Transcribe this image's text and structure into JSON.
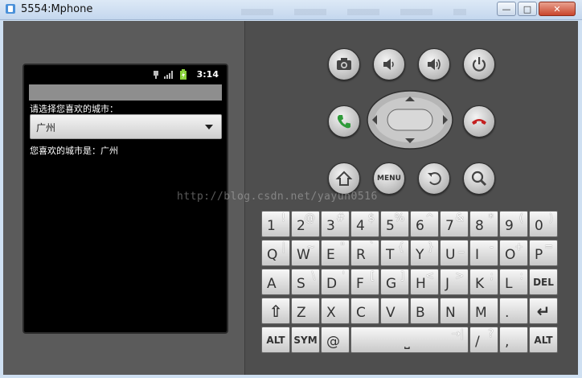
{
  "window": {
    "title": "5554:Mphone",
    "controls": {
      "minimize": "—",
      "maximize": "□",
      "close": "✕"
    }
  },
  "status_bar": {
    "time": "3:14"
  },
  "app": {
    "prompt_label": "请选择您喜欢的城市：",
    "spinner_value": "广州",
    "result_label": "您喜欢的城市是：广州"
  },
  "controls": {
    "camera": "camera-icon",
    "volume_down": "volume-down-icon",
    "volume_up": "volume-up-icon",
    "power": "power-icon",
    "call": "call-icon",
    "end_call": "end-call-icon",
    "home": "home-icon",
    "menu_label": "MENU",
    "back": "back-icon",
    "search": "search-icon"
  },
  "watermark": "http://blog.csdn.net/yayun0516",
  "keyboard": {
    "row1": [
      {
        "main": "1",
        "alt": "!"
      },
      {
        "main": "2",
        "alt": "@"
      },
      {
        "main": "3",
        "alt": "#"
      },
      {
        "main": "4",
        "alt": "$"
      },
      {
        "main": "5",
        "alt": "%"
      },
      {
        "main": "6",
        "alt": "^"
      },
      {
        "main": "7",
        "alt": "&"
      },
      {
        "main": "8",
        "alt": "*"
      },
      {
        "main": "9",
        "alt": "("
      },
      {
        "main": "0",
        "alt": ")"
      }
    ],
    "row2": [
      {
        "main": "Q",
        "alt": "|"
      },
      {
        "main": "W",
        "alt": "~"
      },
      {
        "main": "E",
        "alt": "\""
      },
      {
        "main": "R",
        "alt": "`"
      },
      {
        "main": "T",
        "alt": "{"
      },
      {
        "main": "Y",
        "alt": "}"
      },
      {
        "main": "U",
        "alt": "_"
      },
      {
        "main": "I",
        "alt": "-"
      },
      {
        "main": "O",
        "alt": "+"
      },
      {
        "main": "P",
        "alt": "="
      }
    ],
    "row3": [
      {
        "main": "A",
        "alt": ""
      },
      {
        "main": "S",
        "alt": "\\"
      },
      {
        "main": "D",
        "alt": "'"
      },
      {
        "main": "F",
        "alt": "["
      },
      {
        "main": "G",
        "alt": "]"
      },
      {
        "main": "H",
        "alt": "<"
      },
      {
        "main": "J",
        "alt": ">"
      },
      {
        "main": "K",
        "alt": ";"
      },
      {
        "main": "L",
        "alt": ":"
      },
      {
        "main": "DEL",
        "alt": ""
      }
    ],
    "row4": [
      {
        "main": "⇧",
        "alt": ""
      },
      {
        "main": "Z",
        "alt": ""
      },
      {
        "main": "X",
        "alt": ""
      },
      {
        "main": "C",
        "alt": ""
      },
      {
        "main": "V",
        "alt": ""
      },
      {
        "main": "B",
        "alt": ""
      },
      {
        "main": "N",
        "alt": ""
      },
      {
        "main": "M",
        "alt": ""
      },
      {
        "main": ".",
        "alt": ""
      },
      {
        "main": "↵",
        "alt": ""
      }
    ],
    "row5": [
      {
        "main": "ALT",
        "alt": ""
      },
      {
        "main": "SYM",
        "alt": ""
      },
      {
        "main": "@",
        "alt": ""
      },
      {
        "main": "⎵",
        "alt": "→|"
      },
      {
        "main": "/",
        "alt": "?"
      },
      {
        "main": ",",
        "alt": ""
      },
      {
        "main": "ALT",
        "alt": ""
      }
    ]
  }
}
